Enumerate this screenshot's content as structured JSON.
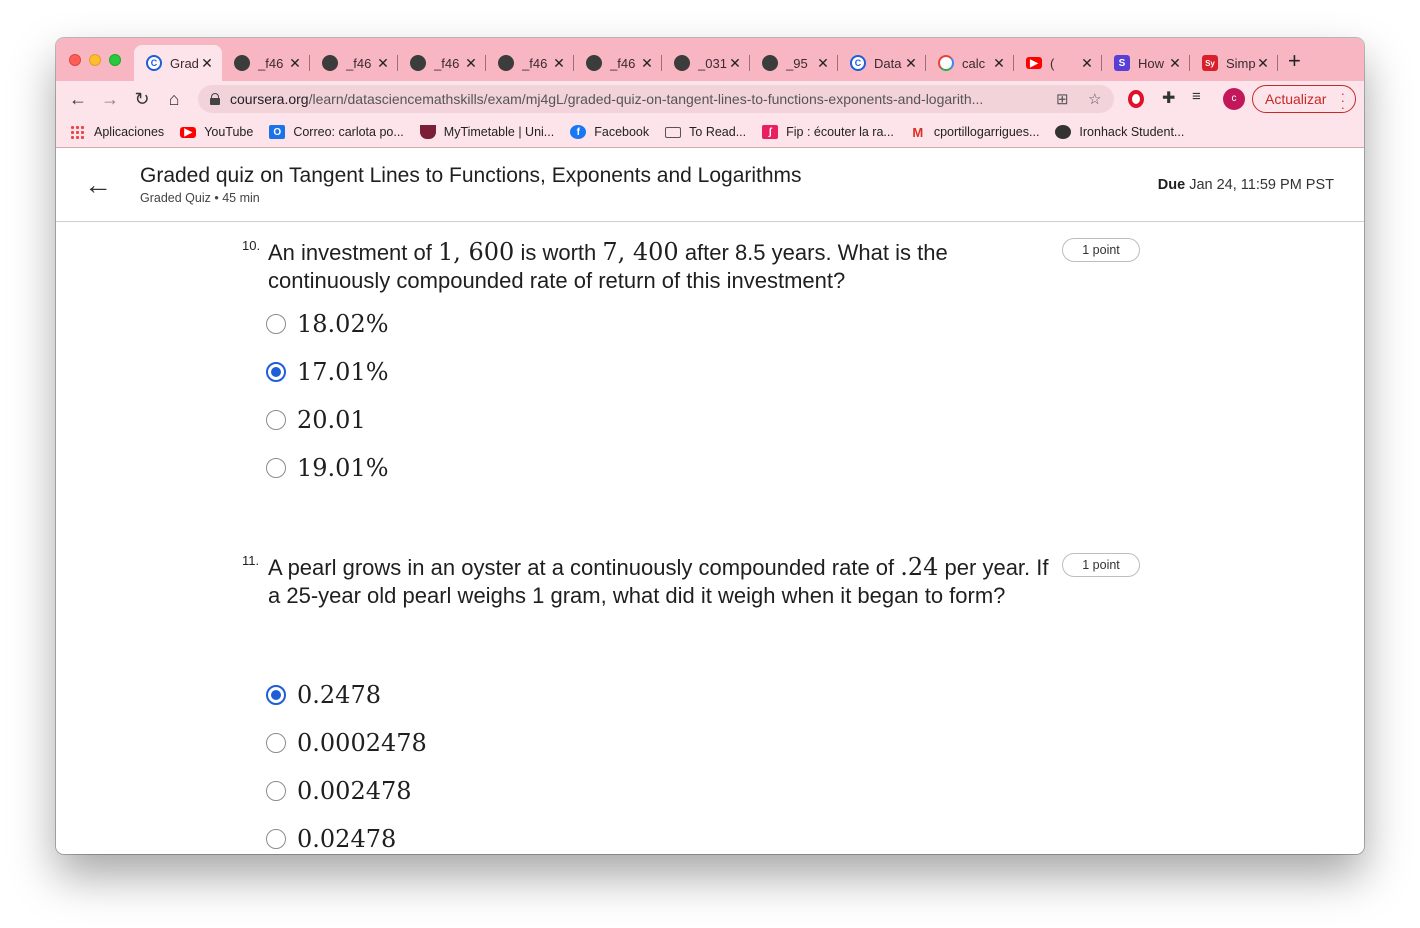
{
  "tabs": [
    {
      "title": "Grad",
      "icon": "coursera-icon",
      "active": true
    },
    {
      "title": "_f46",
      "icon": "globe-icon"
    },
    {
      "title": "_f46",
      "icon": "globe-icon"
    },
    {
      "title": "_f46",
      "icon": "globe-icon"
    },
    {
      "title": "_f46",
      "icon": "globe-icon"
    },
    {
      "title": "_f46",
      "icon": "globe-icon"
    },
    {
      "title": "_031",
      "icon": "globe-icon"
    },
    {
      "title": "_95",
      "icon": "globe-icon"
    },
    {
      "title": "Data",
      "icon": "coursera-icon"
    },
    {
      "title": "calc",
      "icon": "google-icon"
    },
    {
      "title": "(",
      "icon": "youtube-icon"
    },
    {
      "title": "How",
      "icon": "s-icon"
    },
    {
      "title": "Simp",
      "icon": "sy-icon"
    }
  ],
  "toolbar": {
    "url_host": "coursera.org",
    "url_path": "/learn/datasciencemathskills/exam/mj4gL/graded-quiz-on-tangent-lines-to-functions-exponents-and-logarith...",
    "avatar_letter": "c",
    "update_label": "Actualizar"
  },
  "bookmarks": [
    {
      "label": "Aplicaciones",
      "icon": "apps-icon"
    },
    {
      "label": "YouTube",
      "icon": "youtube-icon"
    },
    {
      "label": "Correo: carlota po...",
      "icon": "mail-icon"
    },
    {
      "label": "MyTimetable | Uni...",
      "icon": "shield-icon"
    },
    {
      "label": "Facebook",
      "icon": "facebook-icon"
    },
    {
      "label": "To Read...",
      "icon": "folder-icon"
    },
    {
      "label": "Fip : écouter la ra...",
      "icon": "fip-icon"
    },
    {
      "label": "cportillogarrigues...",
      "icon": "gmail-icon"
    },
    {
      "label": "Ironhack Student...",
      "icon": "globe-icon"
    }
  ],
  "header": {
    "title": "Graded quiz on Tangent Lines to Functions, Exponents and Logarithms",
    "subtitle": "Graded Quiz • 45 min",
    "due_label": "Due",
    "due_value": "Jan 24, 11:59 PM PST"
  },
  "questions": [
    {
      "number": "10.",
      "text_1": "An investment of ",
      "math_1": "1, 600",
      "text_2": " is worth ",
      "math_2": "7, 400",
      "text_3": " after 8.5 years. What is the continuously compounded rate of return of this investment?",
      "points": "1 point",
      "options": [
        {
          "label": "18.02%",
          "checked": false
        },
        {
          "label": "17.01%",
          "checked": true
        },
        {
          "label": "20.01",
          "checked": false
        },
        {
          "label": "19.01%",
          "checked": false
        }
      ]
    },
    {
      "number": "11.",
      "text_1": "A pearl grows in an oyster at a continuously compounded rate of ",
      "math_1": ".24",
      "text_2": " per year. If a 25-year old pearl weighs 1 gram, what did it weigh when it began to form?",
      "points": "1 point",
      "options": [
        {
          "label": "0.2478",
          "checked": true
        },
        {
          "label": "0.0002478",
          "checked": false
        },
        {
          "label": "0.002478",
          "checked": false
        },
        {
          "label": "0.02478",
          "checked": false
        }
      ]
    }
  ]
}
